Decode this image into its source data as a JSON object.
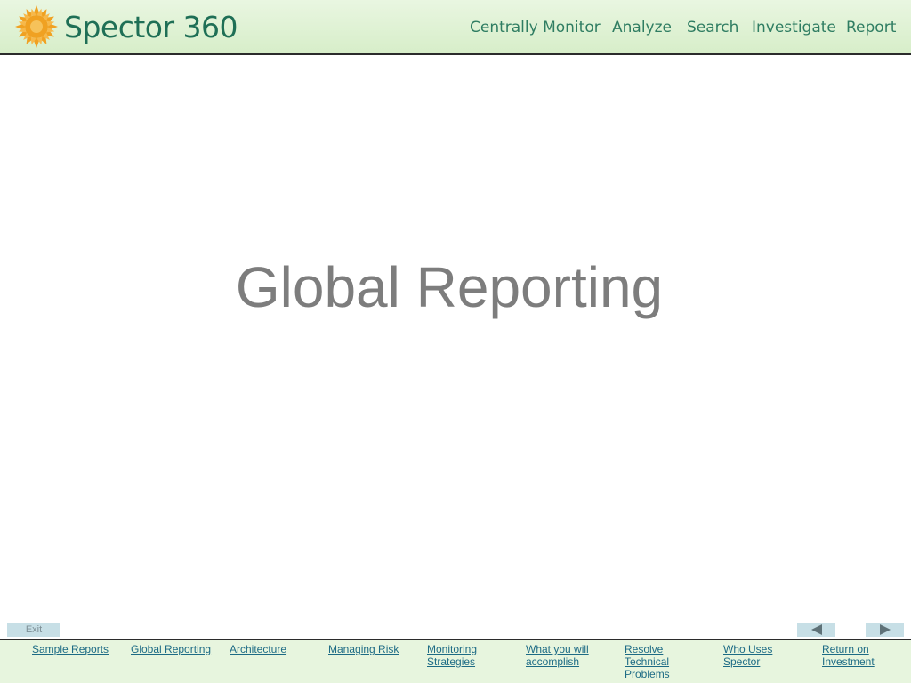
{
  "header": {
    "logo_text": "Spector 360",
    "nav": [
      "Centrally Monitor",
      "Analyze",
      "Search",
      "Investigate",
      "Report"
    ]
  },
  "slide": {
    "title": "Global Reporting"
  },
  "controls": {
    "exit_label": "Exit"
  },
  "footer": {
    "links": [
      [
        "Sample Reports"
      ],
      [
        "Global Reporting"
      ],
      [
        "Architecture"
      ],
      [
        "Managing Risk"
      ],
      [
        "Monitoring",
        "Strategies"
      ],
      [
        "What you will",
        "accomplish"
      ],
      [
        "Resolve",
        "Technical",
        "Problems"
      ],
      [
        "Who Uses",
        "Spector"
      ],
      [
        "Return on",
        "Investment"
      ]
    ]
  },
  "colors": {
    "brand_green": "#1f6f56",
    "nav_green": "#2f7d62",
    "link_blue": "#1d6b85",
    "header_bg": "#e9f6e1"
  },
  "icons": {
    "logo": "sunburst-icon",
    "prev": "triangle-left-icon",
    "next": "triangle-right-icon"
  }
}
